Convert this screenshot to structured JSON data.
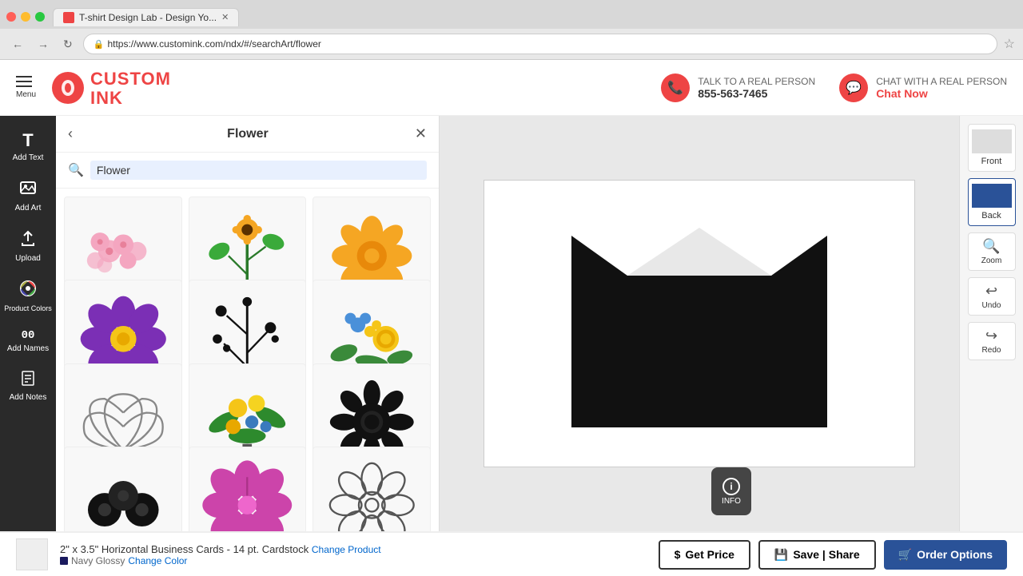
{
  "browser": {
    "tab_title": "T-shirt Design Lab - Design Yo...",
    "url": "https://www.customink.com/ndx/#/searchArt/flower",
    "secure_label": "Secure"
  },
  "header": {
    "menu_label": "Menu",
    "logo_custom": "CUSTOM",
    "logo_ink": "INK",
    "talk_label": "TALK TO A REAL PERSON",
    "phone_number": "855-563-7465",
    "chat_label": "CHAT WITH A REAL PERSON",
    "chat_now": "Chat Now"
  },
  "sidebar": {
    "items": [
      {
        "id": "add-text",
        "icon": "T",
        "label": "Add Text"
      },
      {
        "id": "add-art",
        "icon": "🖼",
        "label": "Add Art"
      },
      {
        "id": "upload",
        "icon": "⬆",
        "label": "Upload"
      },
      {
        "id": "product-colors",
        "icon": "🎨",
        "label": "Product Colors"
      },
      {
        "id": "add-names",
        "icon": "00",
        "label": "Add Names"
      },
      {
        "id": "add-notes",
        "icon": "📝",
        "label": "Add Notes"
      }
    ]
  },
  "art_panel": {
    "title": "Flower",
    "search_value": "Flower",
    "search_placeholder": "Flower"
  },
  "right_panel": {
    "front_label": "Front",
    "back_label": "Back",
    "zoom_label": "Zoom",
    "undo_label": "Undo",
    "redo_label": "Redo"
  },
  "info_button": {
    "label": "INFO"
  },
  "bottom_bar": {
    "product_name": "2\" x 3.5\" Horizontal Business Cards - 14 pt. Cardstock",
    "change_product": "Change Product",
    "color_name": "Navy Glossy",
    "change_color": "Change Color",
    "get_price": "Get Price",
    "save_share": "Save | Share",
    "order_options": "Order Options"
  }
}
